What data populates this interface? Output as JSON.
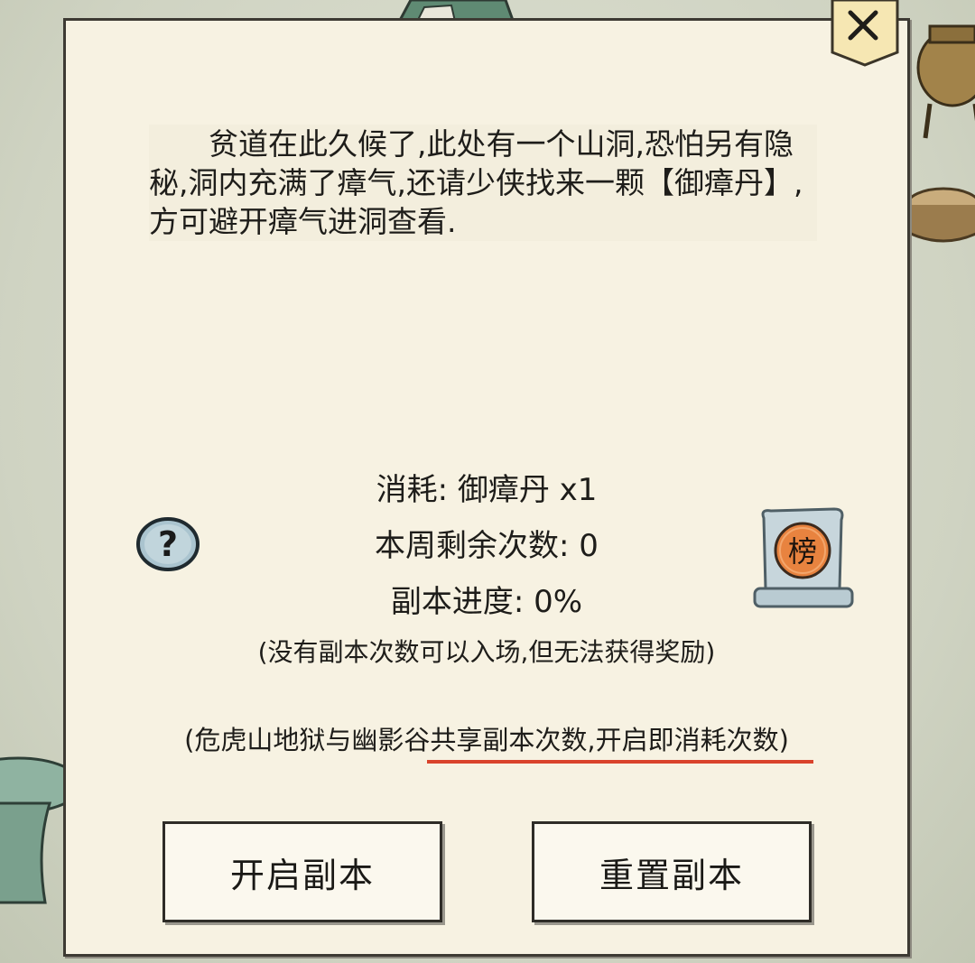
{
  "dialog": {
    "close_icon": "close-x-icon",
    "story_text": "贫道在此久候了,此处有一个山洞,恐怕另有隐秘,洞内充满了瘴气,还请少侠找来一颗【御瘴丹】,方可避开瘴气进洞查看.",
    "cost_line": "消耗: 御瘴丹 x1",
    "remaining_line": "本周剩余次数:  0",
    "progress_line": "副本进度: 0%",
    "no_attempts_note": "(没有副本次数可以入场,但无法获得奖励)",
    "shared_note": "(危虎山地狱与幽影谷共享副本次数,开启即消耗次数)",
    "help_icon": "question-mark-icon",
    "rank_label": "榜",
    "open_button_label": "开启副本",
    "reset_button_label": "重置副本"
  },
  "colors": {
    "panel": "#f7f2e2",
    "underline": "#d9432b",
    "rank_badge": "#e8833f"
  }
}
